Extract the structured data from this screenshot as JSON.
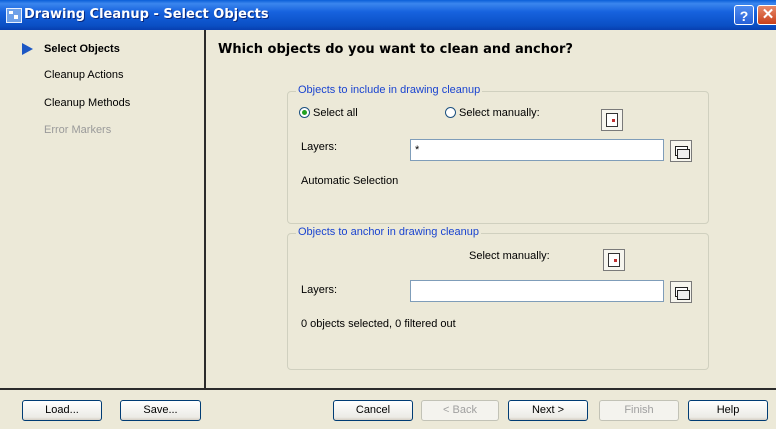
{
  "window": {
    "title": "Drawing Cleanup - Select Objects",
    "help_glyph": "?",
    "close_glyph": "✕",
    "colors": {
      "titlebar": "#0a4fc4",
      "legend_text": "#1a44d0",
      "close": "#c8401a"
    }
  },
  "sidebar": {
    "items": [
      {
        "label": "Select Objects",
        "state": "active"
      },
      {
        "label": "Cleanup Actions",
        "state": "normal"
      },
      {
        "label": "Cleanup Methods",
        "state": "normal"
      },
      {
        "label": "Error Markers",
        "state": "disabled"
      }
    ],
    "active_icon": "triangle-arrow-icon"
  },
  "main": {
    "heading": "Which objects do you want to clean and anchor?",
    "include_group": {
      "legend": "Objects to include in drawing cleanup",
      "select_all_label": "Select all",
      "select_all_checked": true,
      "select_manually_label": "Select manually:",
      "select_manually_checked": false,
      "layers_label": "Layers:",
      "layers_value": "*",
      "status": "Automatic Selection"
    },
    "anchor_group": {
      "legend": "Objects to anchor in drawing cleanup",
      "select_manually_label": "Select manually:",
      "layers_label": "Layers:",
      "layers_value": "",
      "status": "0 objects selected, 0 filtered out"
    }
  },
  "footer": {
    "load": "Load...",
    "save": "Save...",
    "cancel": "Cancel",
    "back": "< Back",
    "next": "Next >",
    "finish": "Finish",
    "help": "Help"
  }
}
